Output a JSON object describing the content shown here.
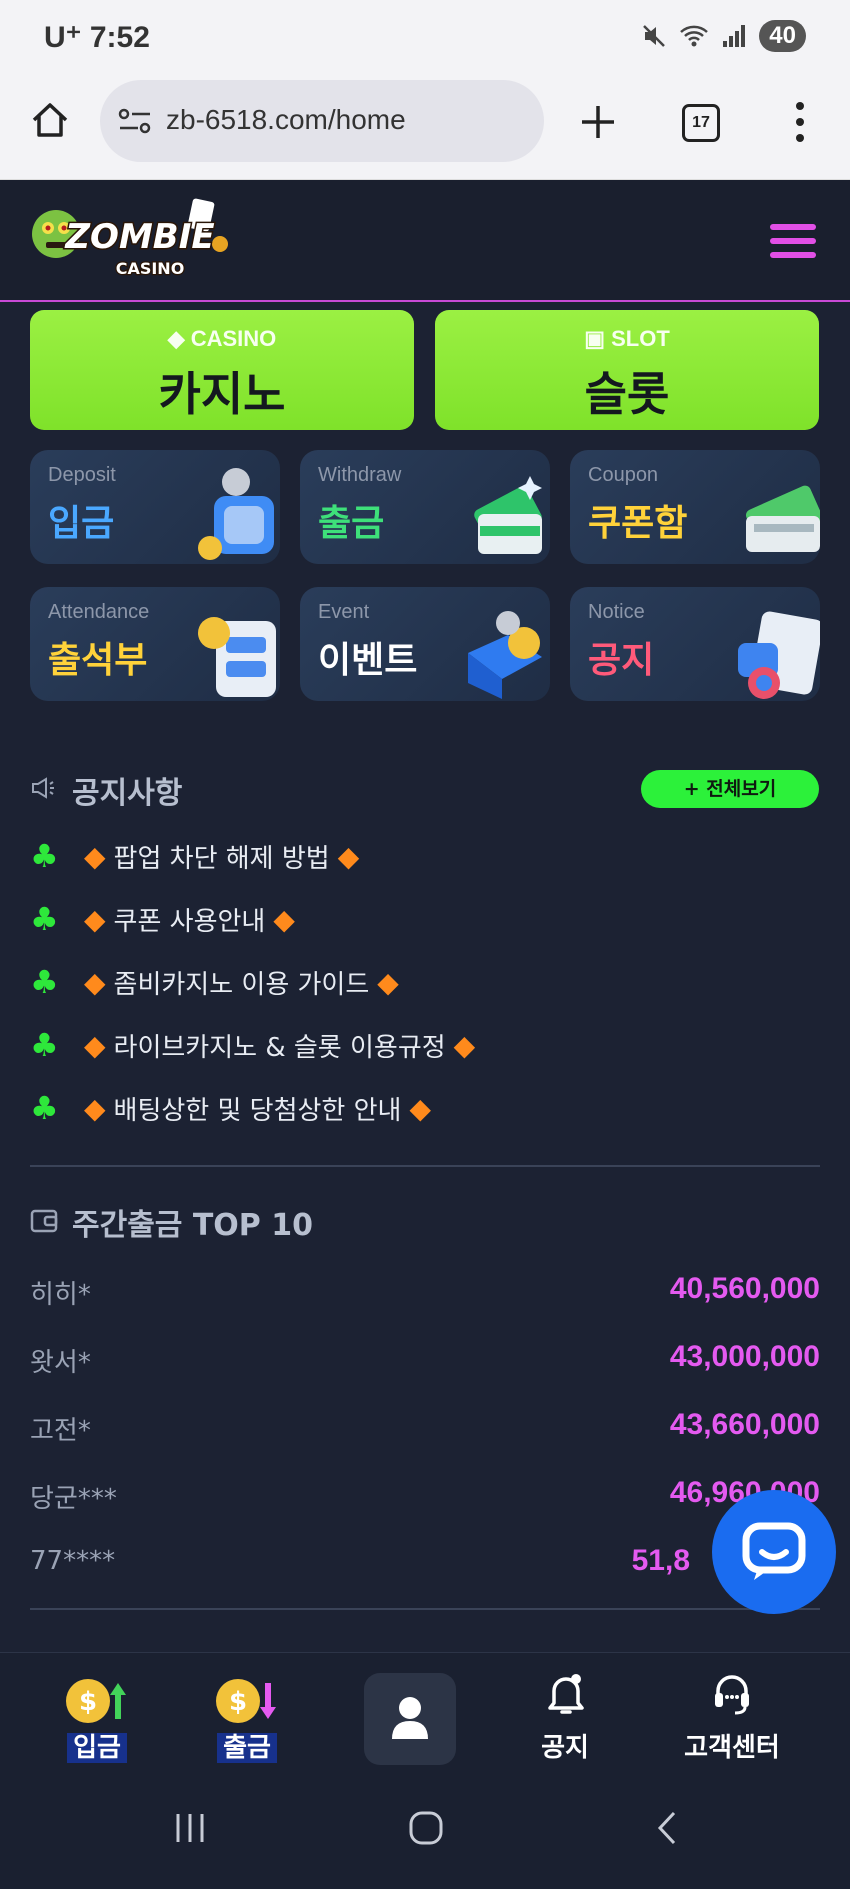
{
  "status_bar": {
    "carrier": "U⁺ 7:52",
    "battery": "40"
  },
  "browser": {
    "url": "zb-6518.com/home",
    "tab_count": "17"
  },
  "header": {
    "logo_text_main": "ZOMBIE",
    "logo_text_sub": "CASINO"
  },
  "games": [
    {
      "en": "CASINO",
      "ko": "카지노"
    },
    {
      "en": "SLOT",
      "ko": "슬롯"
    }
  ],
  "tiles": [
    {
      "en": "Deposit",
      "ko": "입금",
      "color": "#4aa8ff"
    },
    {
      "en": "Withdraw",
      "ko": "출금",
      "color": "#3ee07a"
    },
    {
      "en": "Coupon",
      "ko": "쿠폰함",
      "color": "#ffd23a"
    },
    {
      "en": "Attendance",
      "ko": "출석부",
      "color": "#ffd23a"
    },
    {
      "en": "Event",
      "ko": "이벤트",
      "color": "#ffffff"
    },
    {
      "en": "Notice",
      "ko": "공지",
      "color": "#ff5a7a"
    }
  ],
  "notices": {
    "title": "공지사항",
    "view_all": "+ 전체보기",
    "items": [
      "팝업 차단 해제 방법",
      "쿠폰 사용안내",
      "좀비카지노 이용 가이드",
      "라이브카지노 & 슬롯 이용규정",
      "배팅상한 및 당첨상한 안내"
    ]
  },
  "withdraw_top": {
    "title": "주간출금 TOP 10",
    "rows": [
      {
        "name": "히히*",
        "amount": "40,560,000"
      },
      {
        "name": "왓서*",
        "amount": "43,000,000"
      },
      {
        "name": "고전*",
        "amount": "43,660,000"
      },
      {
        "name": "당군***",
        "amount": "46,960,000"
      },
      {
        "name": "77****",
        "amount": "51,8"
      }
    ]
  },
  "bottom_nav": {
    "deposit": "입금",
    "withdraw": "출금",
    "notice": "공지",
    "support": "고객센터"
  },
  "colors": {
    "accent_green": "#8ce83a",
    "accent_pink": "#e45af0",
    "club_green": "#2ee83b",
    "chat_blue": "#1a6cf0"
  }
}
